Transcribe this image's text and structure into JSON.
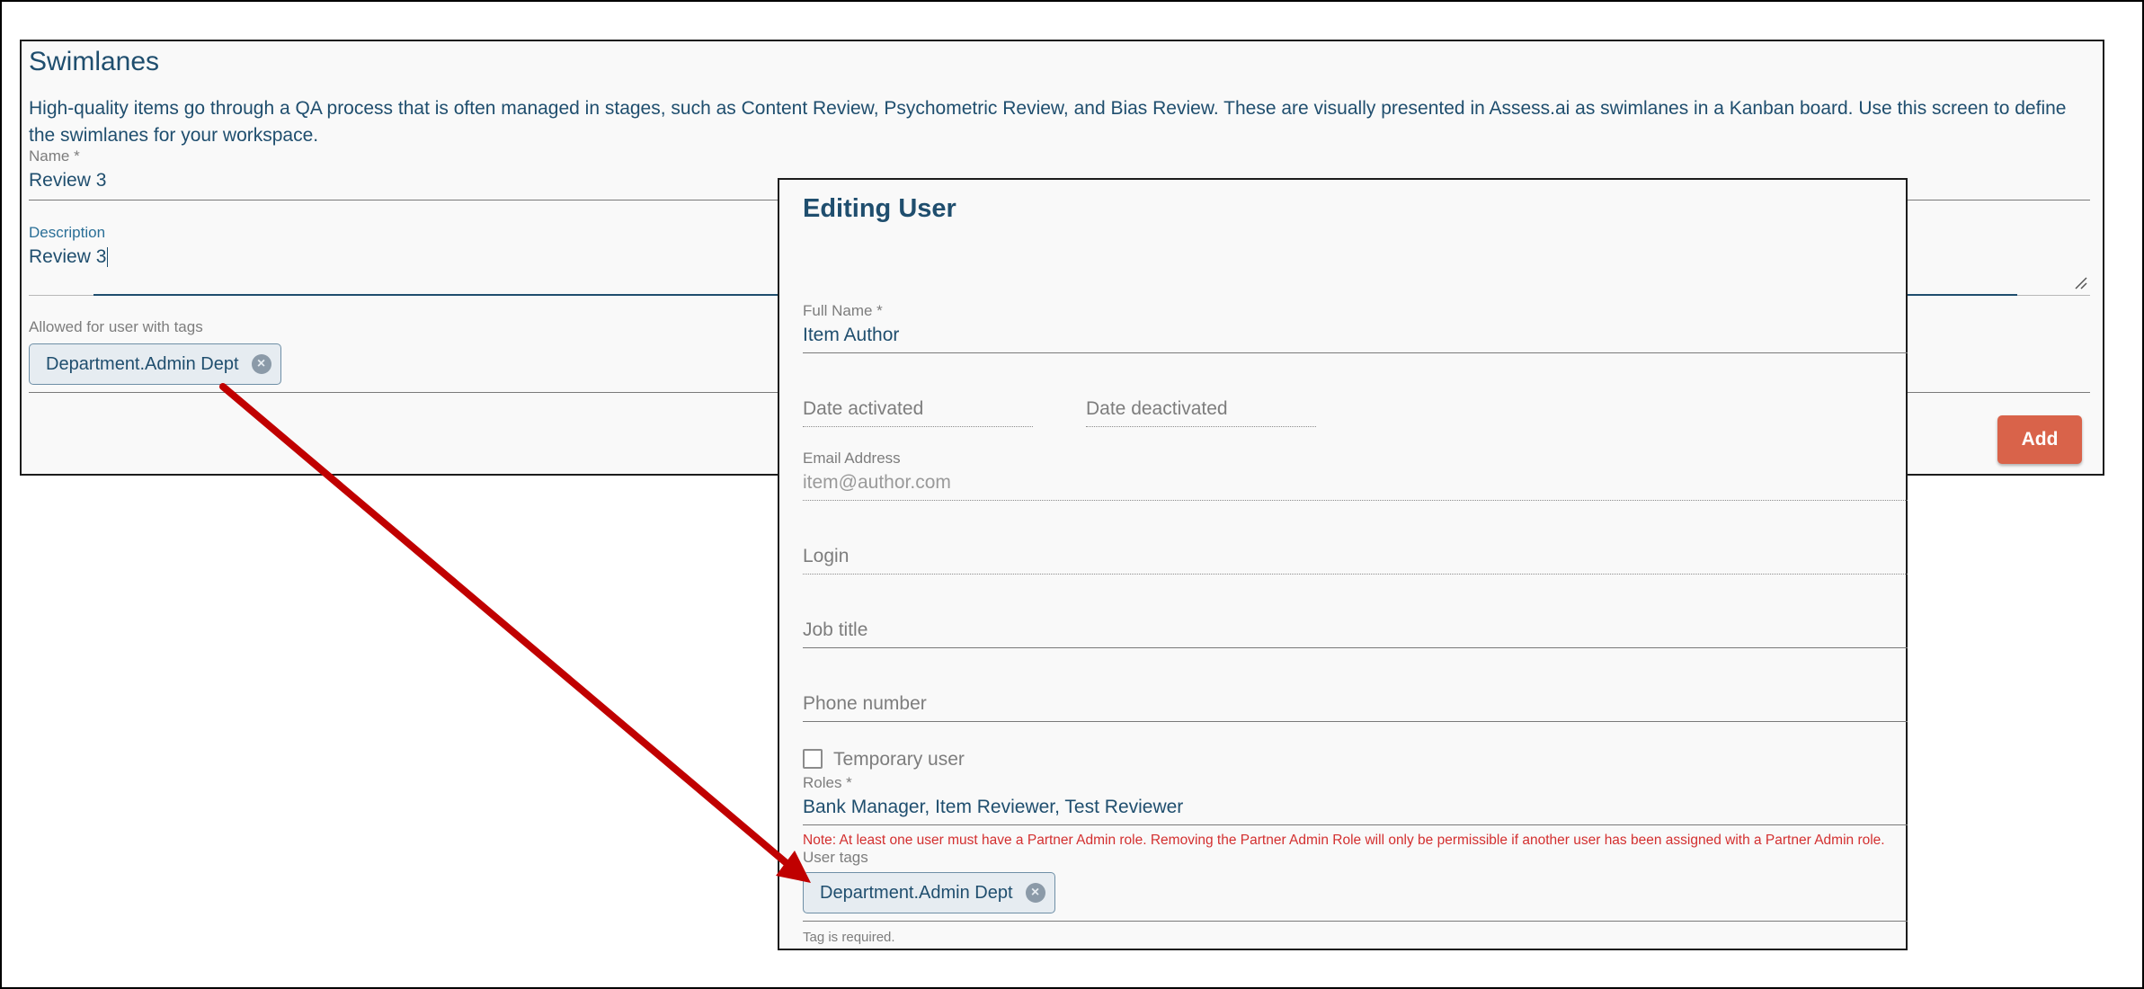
{
  "swimlanes": {
    "title": "Swimlanes",
    "description": "High-quality items go through a QA process that is often managed in stages, such as Content Review, Psychometric Review, and Bias Review. These are visually presented in Assess.ai as swimlanes in a Kanban board. Use this screen to define the swimlanes for your workspace.",
    "name_label": "Name *",
    "name_value": "Review 3",
    "description_label": "Description",
    "description_value": "Review 3",
    "tags_label": "Allowed for user with tags",
    "tags": [
      "Department.Admin Dept"
    ],
    "add_button": "Add"
  },
  "editing_user": {
    "title": "Editing User",
    "full_name_label": "Full Name *",
    "full_name_value": "Item Author",
    "date_activated_placeholder": "Date activated",
    "date_deactivated_placeholder": "Date deactivated",
    "email_label": "Email Address",
    "email_value": "item@author.com",
    "login_placeholder": "Login",
    "job_title_placeholder": "Job title",
    "phone_placeholder": "Phone number",
    "temporary_user_label": "Temporary user",
    "temporary_user_checked": false,
    "roles_label": "Roles *",
    "roles_value": "Bank Manager, Item Reviewer, Test Reviewer",
    "roles_note": "Note: At least one user must have a Partner Admin role. Removing the Partner Admin Role will only be permissible if another user has been assigned with a Partner Admin role.",
    "user_tags_label": "User tags",
    "user_tags": [
      "Department.Admin Dept"
    ],
    "tags_helper": "Tag is required."
  },
  "colors": {
    "accent_text": "#1f4e6e",
    "add_button": "#d9634a",
    "note_red": "#d32f2f",
    "arrow": "#c00000",
    "chip_bg": "#e6ecf1"
  },
  "icons": {
    "chip_remove": "close-circle-icon",
    "resize": "resize-handle-icon",
    "annotation": "arrow-icon"
  }
}
